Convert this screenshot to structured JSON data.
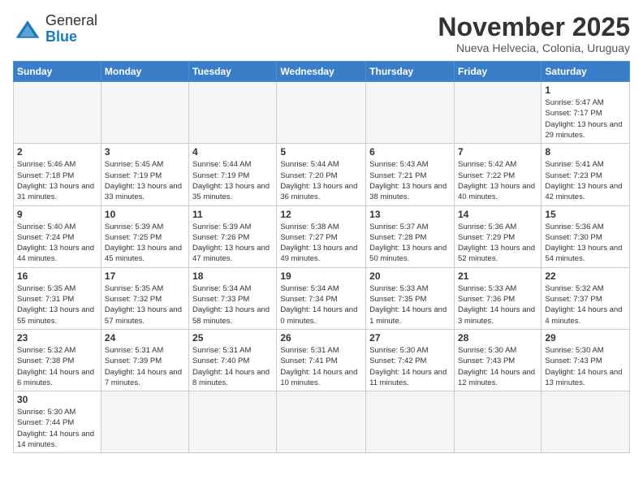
{
  "header": {
    "logo": {
      "general": "General",
      "blue": "Blue"
    },
    "title": "November 2025",
    "location": "Nueva Helvecia, Colonia, Uruguay"
  },
  "days_of_week": [
    "Sunday",
    "Monday",
    "Tuesday",
    "Wednesday",
    "Thursday",
    "Friday",
    "Saturday"
  ],
  "weeks": [
    [
      {
        "day": "",
        "empty": true
      },
      {
        "day": "",
        "empty": true
      },
      {
        "day": "",
        "empty": true
      },
      {
        "day": "",
        "empty": true
      },
      {
        "day": "",
        "empty": true
      },
      {
        "day": "",
        "empty": true
      },
      {
        "day": "1",
        "sunrise": "Sunrise: 5:47 AM",
        "sunset": "Sunset: 7:17 PM",
        "daylight": "Daylight: 13 hours and 29 minutes."
      }
    ],
    [
      {
        "day": "2",
        "sunrise": "Sunrise: 5:46 AM",
        "sunset": "Sunset: 7:18 PM",
        "daylight": "Daylight: 13 hours and 31 minutes."
      },
      {
        "day": "3",
        "sunrise": "Sunrise: 5:45 AM",
        "sunset": "Sunset: 7:19 PM",
        "daylight": "Daylight: 13 hours and 33 minutes."
      },
      {
        "day": "4",
        "sunrise": "Sunrise: 5:44 AM",
        "sunset": "Sunset: 7:19 PM",
        "daylight": "Daylight: 13 hours and 35 minutes."
      },
      {
        "day": "5",
        "sunrise": "Sunrise: 5:44 AM",
        "sunset": "Sunset: 7:20 PM",
        "daylight": "Daylight: 13 hours and 36 minutes."
      },
      {
        "day": "6",
        "sunrise": "Sunrise: 5:43 AM",
        "sunset": "Sunset: 7:21 PM",
        "daylight": "Daylight: 13 hours and 38 minutes."
      },
      {
        "day": "7",
        "sunrise": "Sunrise: 5:42 AM",
        "sunset": "Sunset: 7:22 PM",
        "daylight": "Daylight: 13 hours and 40 minutes."
      },
      {
        "day": "8",
        "sunrise": "Sunrise: 5:41 AM",
        "sunset": "Sunset: 7:23 PM",
        "daylight": "Daylight: 13 hours and 42 minutes."
      }
    ],
    [
      {
        "day": "9",
        "sunrise": "Sunrise: 5:40 AM",
        "sunset": "Sunset: 7:24 PM",
        "daylight": "Daylight: 13 hours and 44 minutes."
      },
      {
        "day": "10",
        "sunrise": "Sunrise: 5:39 AM",
        "sunset": "Sunset: 7:25 PM",
        "daylight": "Daylight: 13 hours and 45 minutes."
      },
      {
        "day": "11",
        "sunrise": "Sunrise: 5:39 AM",
        "sunset": "Sunset: 7:26 PM",
        "daylight": "Daylight: 13 hours and 47 minutes."
      },
      {
        "day": "12",
        "sunrise": "Sunrise: 5:38 AM",
        "sunset": "Sunset: 7:27 PM",
        "daylight": "Daylight: 13 hours and 49 minutes."
      },
      {
        "day": "13",
        "sunrise": "Sunrise: 5:37 AM",
        "sunset": "Sunset: 7:28 PM",
        "daylight": "Daylight: 13 hours and 50 minutes."
      },
      {
        "day": "14",
        "sunrise": "Sunrise: 5:36 AM",
        "sunset": "Sunset: 7:29 PM",
        "daylight": "Daylight: 13 hours and 52 minutes."
      },
      {
        "day": "15",
        "sunrise": "Sunrise: 5:36 AM",
        "sunset": "Sunset: 7:30 PM",
        "daylight": "Daylight: 13 hours and 54 minutes."
      }
    ],
    [
      {
        "day": "16",
        "sunrise": "Sunrise: 5:35 AM",
        "sunset": "Sunset: 7:31 PM",
        "daylight": "Daylight: 13 hours and 55 minutes."
      },
      {
        "day": "17",
        "sunrise": "Sunrise: 5:35 AM",
        "sunset": "Sunset: 7:32 PM",
        "daylight": "Daylight: 13 hours and 57 minutes."
      },
      {
        "day": "18",
        "sunrise": "Sunrise: 5:34 AM",
        "sunset": "Sunset: 7:33 PM",
        "daylight": "Daylight: 13 hours and 58 minutes."
      },
      {
        "day": "19",
        "sunrise": "Sunrise: 5:34 AM",
        "sunset": "Sunset: 7:34 PM",
        "daylight": "Daylight: 14 hours and 0 minutes."
      },
      {
        "day": "20",
        "sunrise": "Sunrise: 5:33 AM",
        "sunset": "Sunset: 7:35 PM",
        "daylight": "Daylight: 14 hours and 1 minute."
      },
      {
        "day": "21",
        "sunrise": "Sunrise: 5:33 AM",
        "sunset": "Sunset: 7:36 PM",
        "daylight": "Daylight: 14 hours and 3 minutes."
      },
      {
        "day": "22",
        "sunrise": "Sunrise: 5:32 AM",
        "sunset": "Sunset: 7:37 PM",
        "daylight": "Daylight: 14 hours and 4 minutes."
      }
    ],
    [
      {
        "day": "23",
        "sunrise": "Sunrise: 5:32 AM",
        "sunset": "Sunset: 7:38 PM",
        "daylight": "Daylight: 14 hours and 6 minutes."
      },
      {
        "day": "24",
        "sunrise": "Sunrise: 5:31 AM",
        "sunset": "Sunset: 7:39 PM",
        "daylight": "Daylight: 14 hours and 7 minutes."
      },
      {
        "day": "25",
        "sunrise": "Sunrise: 5:31 AM",
        "sunset": "Sunset: 7:40 PM",
        "daylight": "Daylight: 14 hours and 8 minutes."
      },
      {
        "day": "26",
        "sunrise": "Sunrise: 5:31 AM",
        "sunset": "Sunset: 7:41 PM",
        "daylight": "Daylight: 14 hours and 10 minutes."
      },
      {
        "day": "27",
        "sunrise": "Sunrise: 5:30 AM",
        "sunset": "Sunset: 7:42 PM",
        "daylight": "Daylight: 14 hours and 11 minutes."
      },
      {
        "day": "28",
        "sunrise": "Sunrise: 5:30 AM",
        "sunset": "Sunset: 7:43 PM",
        "daylight": "Daylight: 14 hours and 12 minutes."
      },
      {
        "day": "29",
        "sunrise": "Sunrise: 5:30 AM",
        "sunset": "Sunset: 7:43 PM",
        "daylight": "Daylight: 14 hours and 13 minutes."
      }
    ],
    [
      {
        "day": "30",
        "sunrise": "Sunrise: 5:30 AM",
        "sunset": "Sunset: 7:44 PM",
        "daylight": "Daylight: 14 hours and 14 minutes."
      },
      {
        "day": "",
        "empty": true
      },
      {
        "day": "",
        "empty": true
      },
      {
        "day": "",
        "empty": true
      },
      {
        "day": "",
        "empty": true
      },
      {
        "day": "",
        "empty": true
      },
      {
        "day": "",
        "empty": true
      }
    ]
  ]
}
